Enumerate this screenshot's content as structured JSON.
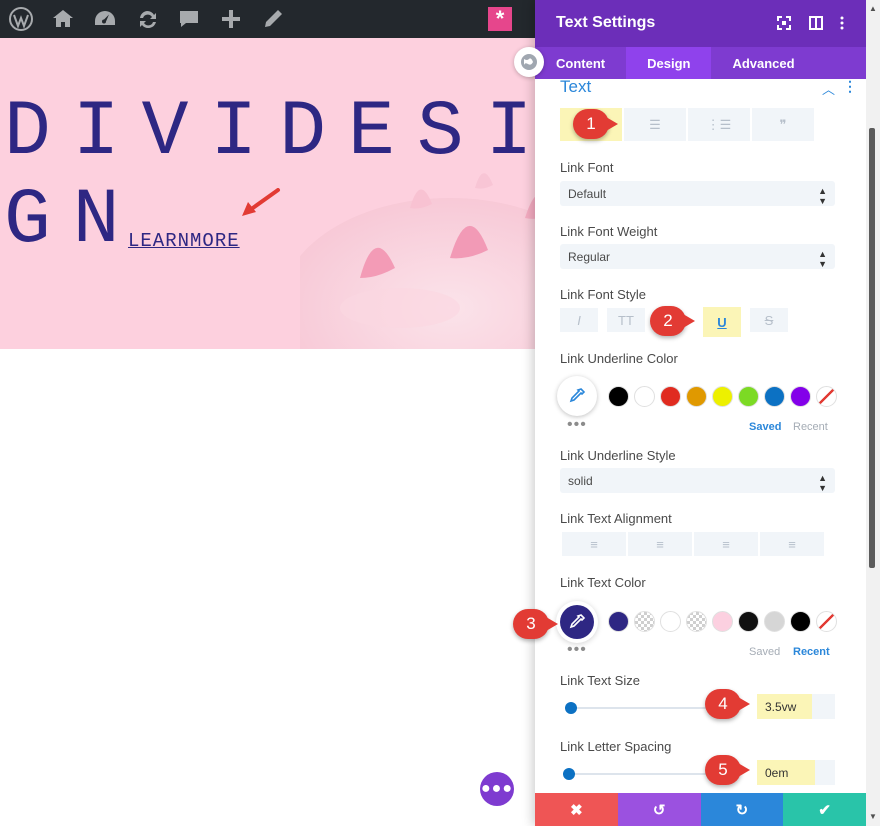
{
  "admin_bar": {
    "icons": [
      "wordpress-icon",
      "my-sites-icon",
      "dashboard-icon",
      "updates-icon",
      "comments-icon",
      "new-icon",
      "edit-icon"
    ],
    "divi_button": "*"
  },
  "hero": {
    "line1": "DIVIDESI",
    "line2": "GN",
    "link": "LEARNMORE"
  },
  "panel": {
    "title": "Text Settings",
    "tabs": [
      "Content",
      "Design",
      "Advanced"
    ],
    "active_tab": "Design",
    "section_title": "Text",
    "text_tabs": {
      "icons": [
        "link-icon",
        "list-icon",
        "ordered-list-icon",
        "quote-icon"
      ],
      "selected": "link-icon"
    },
    "link_font": {
      "label": "Link Font",
      "value": "Default"
    },
    "link_font_weight": {
      "label": "Link Font Weight",
      "value": "Regular"
    },
    "link_font_style": {
      "label": "Link Font Style",
      "buttons": [
        "I",
        "TT",
        "U",
        "S"
      ],
      "selected": "U"
    },
    "link_underline_color": {
      "label": "Link Underline Color",
      "swatches": [
        "#000000",
        "#ffffff",
        "#e02b20",
        "#e09900",
        "#edf000",
        "#7cda24",
        "#0c71c3",
        "#8300e9"
      ],
      "saved_label": "Saved",
      "recent_label": "Recent",
      "active_tab": "Saved"
    },
    "link_underline_style": {
      "label": "Link Underline Style",
      "value": "solid"
    },
    "link_text_alignment": {
      "label": "Link Text Alignment",
      "options": [
        "left",
        "center",
        "right",
        "justify"
      ]
    },
    "link_text_color": {
      "label": "Link Text Color",
      "current_color": "#2e2783",
      "swatches": [
        "#2e2783",
        "checker",
        "#ffffff",
        "checker",
        "#fcd0e0",
        "#111111",
        "#d6d6d6",
        "#000000"
      ],
      "saved_label": "Saved",
      "recent_label": "Recent",
      "active_tab": "Recent"
    },
    "link_text_size": {
      "label": "Link Text Size",
      "value": "3.5vw",
      "slider_fraction": 0.0
    },
    "link_letter_spacing": {
      "label": "Link Letter Spacing",
      "value": "0em",
      "slider_fraction": 0.0
    }
  },
  "callouts": [
    "1",
    "2",
    "3",
    "4",
    "5"
  ],
  "colors": {
    "header": "#6c2eb9",
    "tabs": "#7e3bd0",
    "active_tab": "#8f42ec",
    "accent": "#2b87da",
    "highlight": "#fbf5b7",
    "callout": "#e23b34",
    "footer": [
      "#ef5555",
      "#9b51e0",
      "#2b87da",
      "#29c4a9"
    ]
  }
}
